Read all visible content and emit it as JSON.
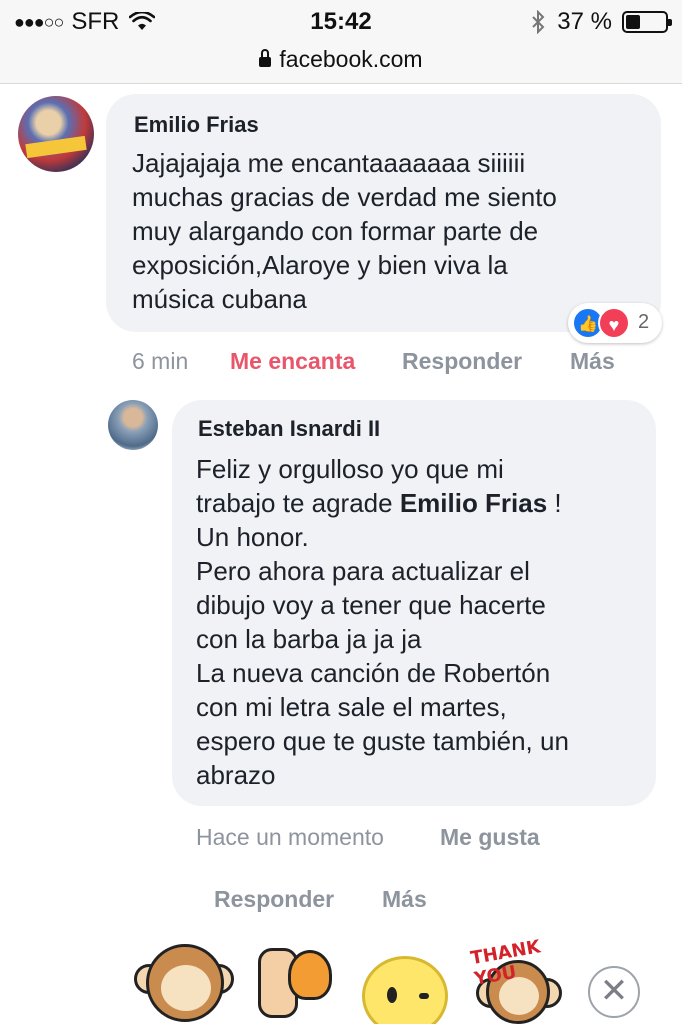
{
  "status_bar": {
    "carrier_dots": "●●●○○",
    "carrier": "SFR",
    "wifi_icon": "wifi-icon",
    "time": "15:42",
    "bluetooth_icon": "bluetooth-icon",
    "battery_percent": "37 %",
    "battery_level": 0.37
  },
  "browser": {
    "url": "facebook.com",
    "lock_icon": "lock-icon"
  },
  "comments": [
    {
      "author": "Emilio Frias",
      "text": "Jajajajaja me encantaaaaaaa siiiiii\nmuchas gracias de verdad me siento\nmuy alargando con formar parte de\nexposición,Alaroye y bien viva la\nmúsica cubana",
      "reaction_count": "2",
      "time": "6 min",
      "reaction_label": "Me encanta",
      "reply_label": "Responder",
      "more_label": "Más"
    },
    {
      "author": "Esteban Isnardi II",
      "text_before": "Feliz y orgulloso yo que mi\ntrabajo te agrade ",
      "mention": "Emilio Frias",
      "text_after": " !\nUn honor.\nPero ahora para actualizar el\ndibujo voy a tener que hacerte\ncon la barba ja ja ja\nLa nueva canción de Robertón\ncon mi letra sale el martes,\nespero que te guste también, un\nabrazo",
      "time": "Hace un momento",
      "like_label": "Me gusta",
      "reply_label": "Responder",
      "more_label": "Más"
    }
  ],
  "sticker_tray": {
    "sticker_thank_text": "THANK YOU",
    "close_symbol": "✕"
  }
}
